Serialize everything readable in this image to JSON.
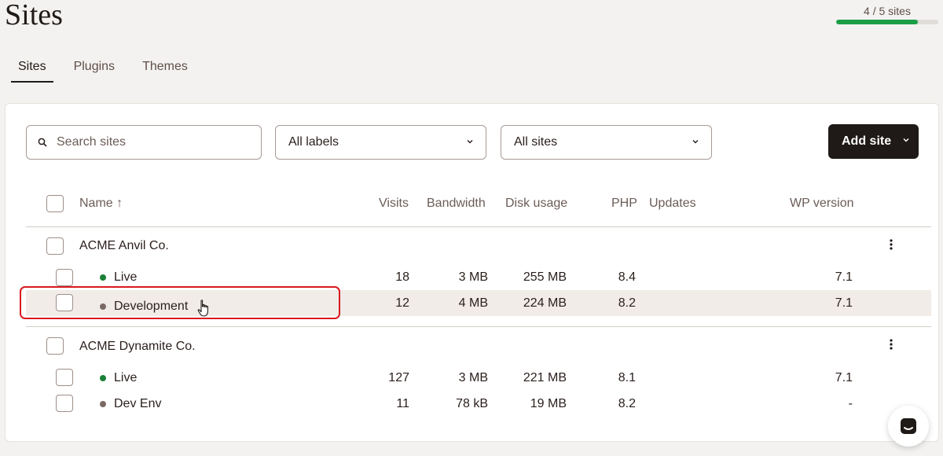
{
  "page": {
    "title": "Sites"
  },
  "usage": {
    "label": "4 / 5 sites",
    "used": 4,
    "total": 5,
    "color": "#1a9e46"
  },
  "tabs": [
    {
      "label": "Sites",
      "active": true
    },
    {
      "label": "Plugins",
      "active": false
    },
    {
      "label": "Themes",
      "active": false
    }
  ],
  "filters": {
    "search_placeholder": "Search sites",
    "labels_value": "All labels",
    "sites_value": "All sites",
    "add_site_label": "Add site"
  },
  "table": {
    "headers": {
      "name": "Name ↑",
      "visits": "Visits",
      "bandwidth": "Bandwidth",
      "disk": "Disk usage",
      "php": "PHP",
      "updates": "Updates",
      "wp": "WP version"
    },
    "groups": [
      {
        "name": "ACME Anvil Co.",
        "environments": [
          {
            "name": "Live",
            "status": "live",
            "visits": "18",
            "bandwidth": "3 MB",
            "disk": "255 MB",
            "php": "8.4",
            "wp": "7.1"
          },
          {
            "name": "Development",
            "status": "dev",
            "visits": "12",
            "bandwidth": "4 MB",
            "disk": "224 MB",
            "php": "8.2",
            "wp": "7.1"
          }
        ]
      },
      {
        "name": "ACME Dynamite Co.",
        "environments": [
          {
            "name": "Live",
            "status": "live",
            "visits": "127",
            "bandwidth": "3 MB",
            "disk": "221 MB",
            "php": "8.1",
            "wp": "7.1"
          },
          {
            "name": "Dev Env",
            "status": "dev",
            "visits": "11",
            "bandwidth": "78 kB",
            "disk": "19 MB",
            "php": "8.2",
            "wp": "-"
          }
        ]
      }
    ]
  },
  "colors": {
    "live": "#1a7f37",
    "dev": "#7a6a66",
    "highlight": "#d9191e"
  }
}
